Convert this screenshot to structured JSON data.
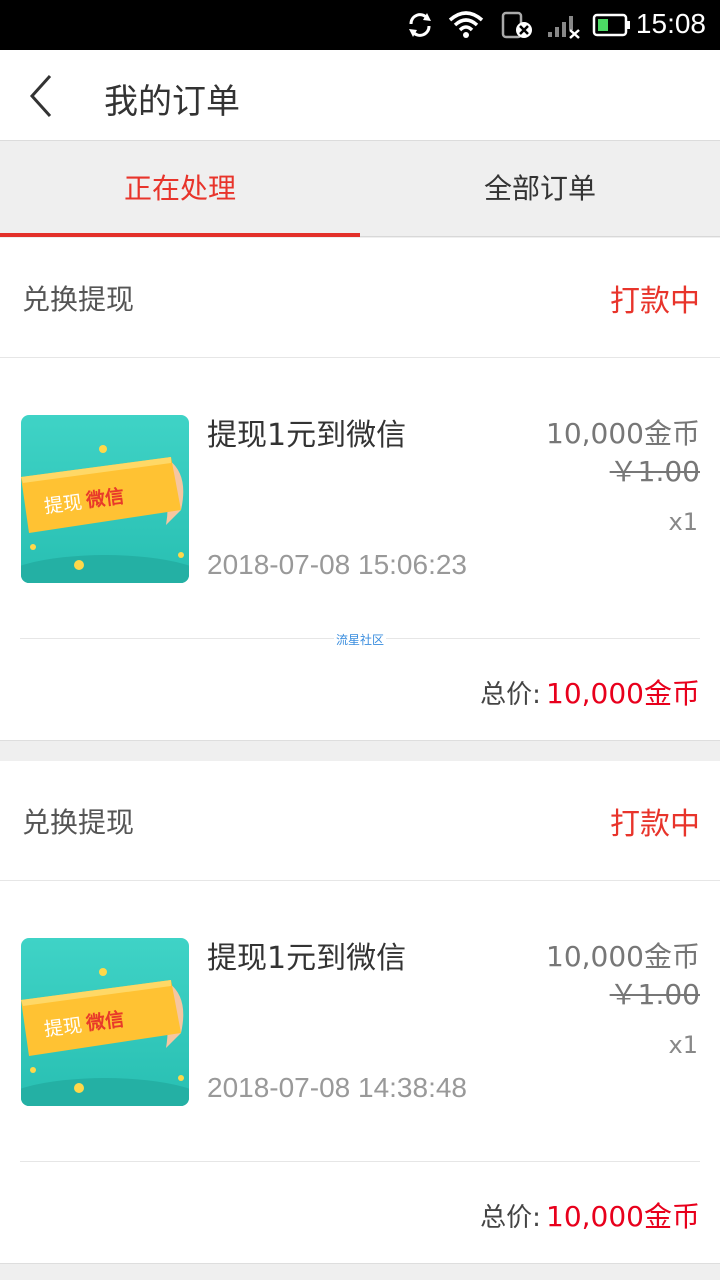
{
  "status_bar": {
    "time": "15:08",
    "icons": [
      "sync-icon",
      "wifi-icon",
      "sim-off-icon",
      "signal-icon",
      "battery-icon"
    ]
  },
  "header": {
    "title": "我的订单",
    "back_icon": "back-arrow-icon"
  },
  "tabs": [
    {
      "label": "正在处理",
      "active": true
    },
    {
      "label": "全部订单",
      "active": false
    }
  ],
  "orders": [
    {
      "type": "兑换提现",
      "status": "打款中",
      "item": {
        "name": "提现1元到微信",
        "image_text_1": "提现",
        "image_text_2": "微信",
        "price": "10,000金币",
        "original_price": "￥1.00",
        "quantity": "x1",
        "time": "2018-07-08 15:06:23"
      },
      "watermark": "流星社区",
      "total_label": "总价:",
      "total_value": "10,000金币"
    },
    {
      "type": "兑换提现",
      "status": "打款中",
      "item": {
        "name": "提现1元到微信",
        "image_text_1": "提现",
        "image_text_2": "微信",
        "price": "10,000金币",
        "original_price": "￥1.00",
        "quantity": "x1",
        "time": "2018-07-08 14:38:48"
      },
      "total_label": "总价:",
      "total_value": "10,000金币"
    }
  ],
  "colors": {
    "accent": "#e8342b",
    "price_red": "#e8001c",
    "background": "#efefef"
  }
}
